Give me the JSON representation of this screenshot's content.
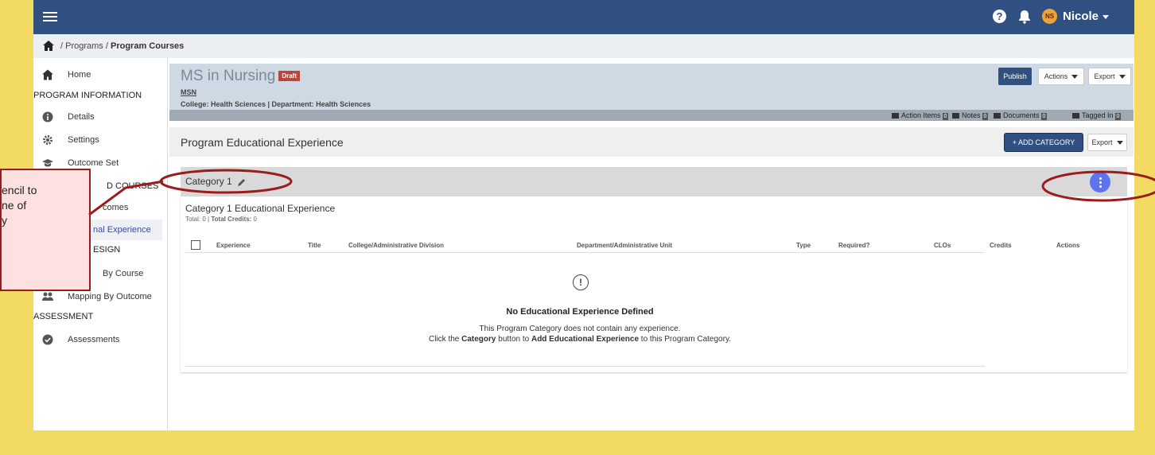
{
  "topbar": {
    "user_initials": "NS",
    "user_name": "Nicole",
    "help_glyph": "?"
  },
  "breadcrumb": {
    "item1": "Programs",
    "item2": "Program Courses"
  },
  "sidebar": {
    "items": [
      {
        "label": "Home",
        "icon": "home-icon"
      },
      {
        "label": "PROGRAM INFORMATION"
      },
      {
        "label": "Details",
        "icon": "info-icon"
      },
      {
        "label": "Settings",
        "icon": "gear-icon"
      },
      {
        "label": "Outcome Set",
        "icon": "graduation-cap-icon"
      },
      {
        "label": "D COURSES"
      },
      {
        "label": "comes"
      },
      {
        "label": "nal Experience"
      },
      {
        "label": "ESIGN"
      },
      {
        "label": "By Course"
      },
      {
        "label": "Mapping By Outcome",
        "icon": "users-icon"
      },
      {
        "label": "ASSESSMENT"
      },
      {
        "label": "Assessments",
        "icon": "check-circle-icon"
      }
    ]
  },
  "program": {
    "title": "MS in Nursing",
    "badge": "Draft",
    "abbr": "MSN",
    "meta": "College: Health Sciences | Department: Health Sciences",
    "publish": "Publish",
    "actions": "Actions",
    "export": "Export",
    "links": {
      "action_items": "Action Items",
      "notes": "Notes",
      "documents": "Documents",
      "tagged": "Tagged In",
      "count": "0"
    }
  },
  "section": {
    "title": "Program Educational Experience",
    "add_category": "+ ADD CATEGORY",
    "export": "Export"
  },
  "category": {
    "title": "Category 1",
    "heading": "Category 1 Educational Experience",
    "total_label": "Total:",
    "total_value": "0",
    "credits_label": "Total Credits:",
    "credits_value": "0",
    "columns": [
      "Experience",
      "Title",
      "College/Administrative Division",
      "Department/Administrative Unit",
      "Type",
      "Required?",
      "CLOs",
      "Credits",
      "Actions"
    ],
    "empty": {
      "icon": "!",
      "title": "No Educational Experience Defined",
      "line1": "This Program Category does not contain any experience.",
      "line2_a": "Click the ",
      "line2_b": "Category",
      "line2_c": " button to ",
      "line2_d": "Add Educational Experience",
      "line2_e": " to this Program Category."
    }
  },
  "callout": {
    "text": "encil to\nne of\ny"
  },
  "colors": {
    "topbar": "#2f5080",
    "accent": "#5c74ee",
    "annotation": "#9b1c1c",
    "background": "#f2da63"
  }
}
